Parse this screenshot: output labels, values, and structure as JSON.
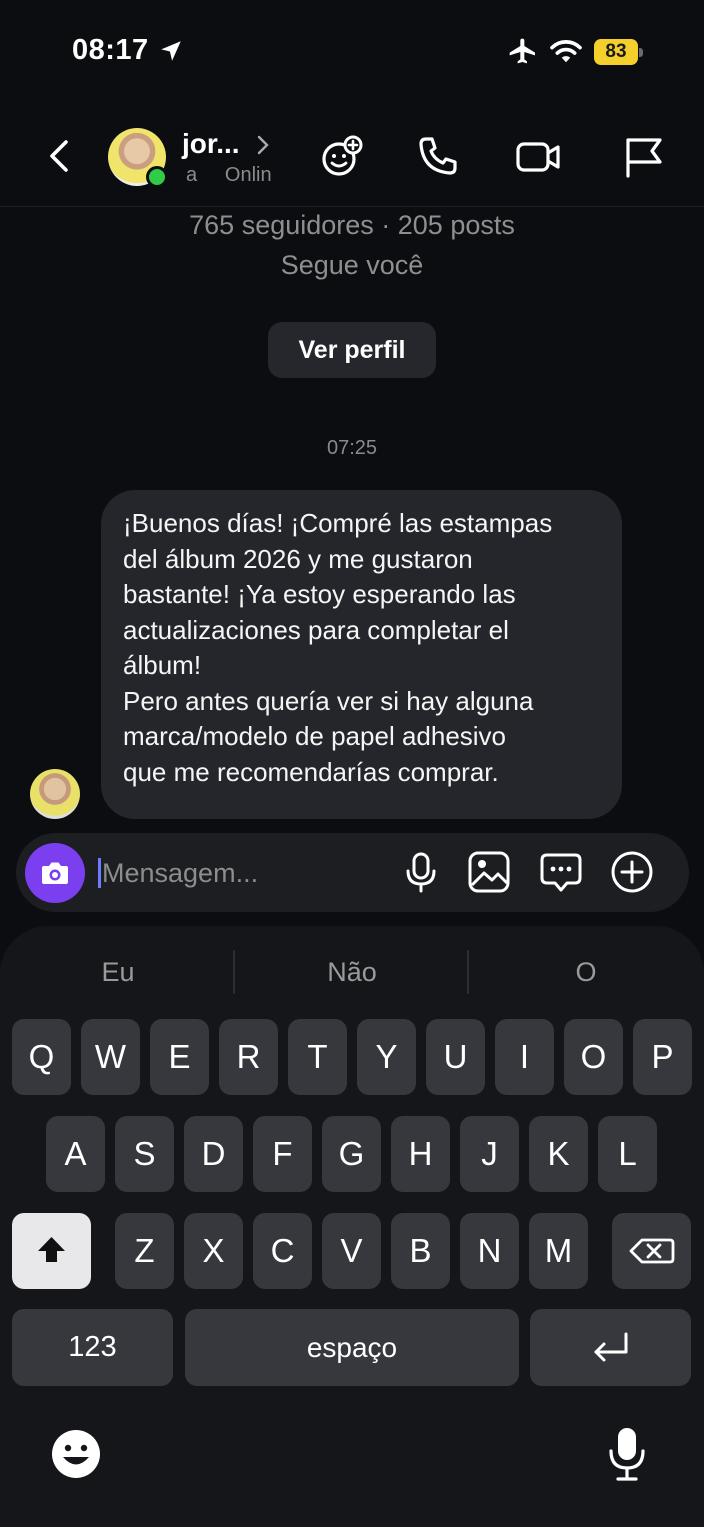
{
  "status_bar": {
    "time": "08:17",
    "battery": "83"
  },
  "header": {
    "name": "jor...",
    "status_prefix": "a",
    "status": "Onlin"
  },
  "profile": {
    "stats": "765 seguidores · 205 posts",
    "follows_you": "Segue você",
    "view_profile_label": "Ver perfil"
  },
  "conversation": {
    "timestamp": "07:25",
    "message": "¡Buenos días! ¡Compré las estampas\ndel álbum 2026 y me gustaron\nbastante! ¡Ya estoy esperando las\nactualizaciones para completar el\nálbum!\nPero antes quería ver si hay alguna\nmarca/modelo de papel adhesivo\nque me recomendarías comprar."
  },
  "composer": {
    "placeholder": "Mensagem..."
  },
  "keyboard": {
    "suggestions": [
      "Eu",
      "Não",
      "O"
    ],
    "row1": [
      "Q",
      "W",
      "E",
      "R",
      "T",
      "Y",
      "U",
      "I",
      "O",
      "P"
    ],
    "row2": [
      "A",
      "S",
      "D",
      "F",
      "G",
      "H",
      "J",
      "K",
      "L"
    ],
    "row3": [
      "Z",
      "X",
      "C",
      "V",
      "B",
      "N",
      "M"
    ],
    "numbers_label": "123",
    "space_label": "espaço"
  },
  "icons": {
    "location": "location-arrow-icon",
    "airplane": "airplane-icon",
    "wifi": "wifi-icon",
    "back": "chevron-left-icon",
    "sticker": "sticker-icon",
    "call": "phone-icon",
    "video": "video-camera-icon",
    "report": "flag-icon",
    "camera": "camera-icon",
    "mic": "microphone-icon",
    "gallery": "image-icon",
    "chat": "chat-bubble-icon",
    "plus": "plus-circle-icon",
    "shift": "shift-arrow-icon",
    "delete": "backspace-icon",
    "return": "return-icon",
    "emoji": "emoji-icon",
    "dictation": "microphone-icon"
  },
  "colors": {
    "background": "#0c0d10",
    "bubble": "#24262b",
    "accent": "#7b3ff0",
    "online": "#2fcc48",
    "battery": "#f5cf2c"
  }
}
